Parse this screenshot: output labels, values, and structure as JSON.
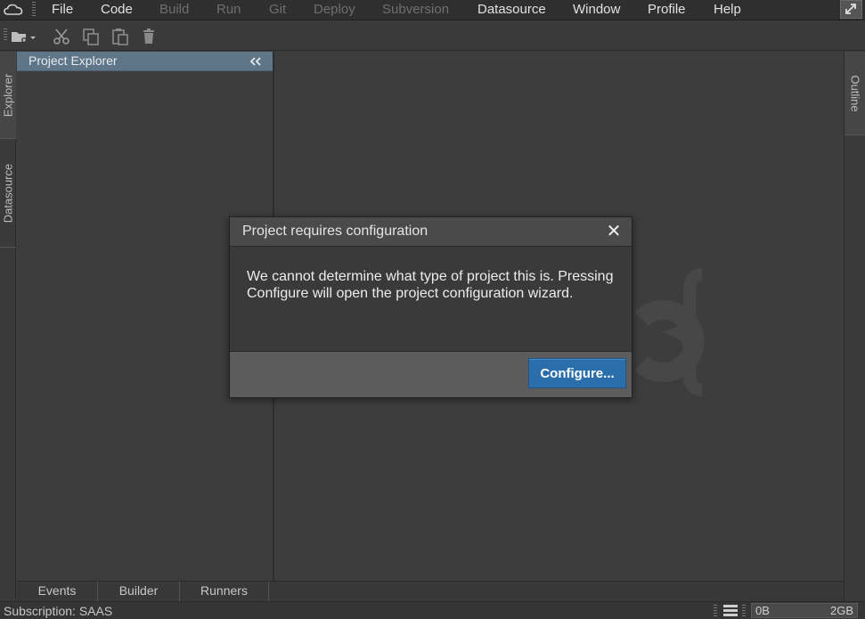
{
  "menubar": {
    "items": [
      {
        "label": "File",
        "enabled": true
      },
      {
        "label": "Code",
        "enabled": true
      },
      {
        "label": "Build",
        "enabled": false
      },
      {
        "label": "Run",
        "enabled": false
      },
      {
        "label": "Git",
        "enabled": false
      },
      {
        "label": "Deploy",
        "enabled": false
      },
      {
        "label": "Subversion",
        "enabled": false
      },
      {
        "label": "Datasource",
        "enabled": true
      },
      {
        "label": "Window",
        "enabled": true
      },
      {
        "label": "Profile",
        "enabled": true
      },
      {
        "label": "Help",
        "enabled": true
      }
    ]
  },
  "left_tabs": [
    "Explorer",
    "Datasource"
  ],
  "right_tabs": [
    "Outline"
  ],
  "explorer": {
    "title": "Project Explorer"
  },
  "bottom_tabs": [
    "Events",
    "Builder",
    "Runners"
  ],
  "status": {
    "subscription": "Subscription: SAAS",
    "memory_used": "0B",
    "memory_total": "2GB"
  },
  "dialog": {
    "title": "Project requires configuration",
    "close_glyph": "✕",
    "message": "We cannot determine what type of project this is. Pressing Configure will open the project configuration wizard.",
    "configure_label": "Configure..."
  },
  "colors": {
    "accent_button": "#2a6fab",
    "panel_header": "#5f7588",
    "background": "#3d3d3d"
  }
}
